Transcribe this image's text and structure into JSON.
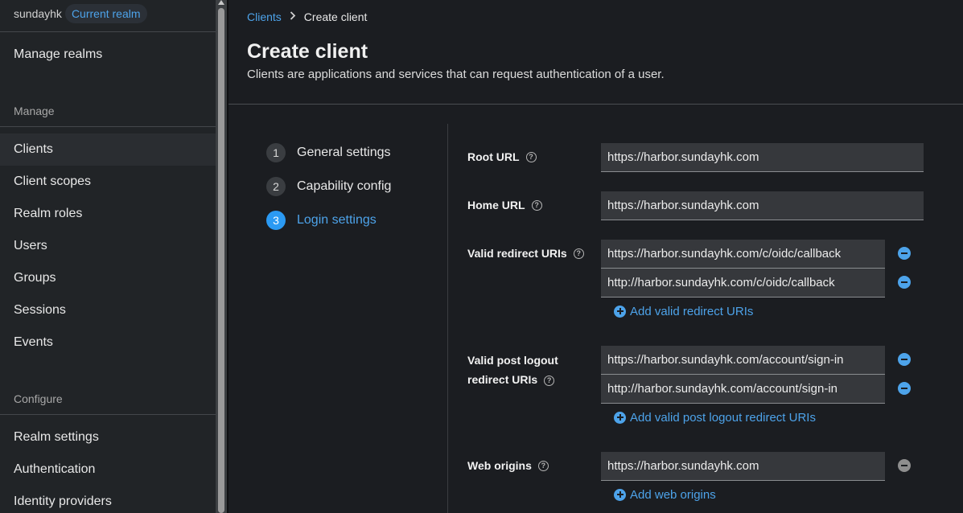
{
  "sidebar": {
    "realm_name": "sundayhk",
    "realm_badge": "Current realm",
    "manage_realms": "Manage realms",
    "manage_section": "Manage",
    "manage_items": [
      {
        "label": "Clients"
      },
      {
        "label": "Client scopes"
      },
      {
        "label": "Realm roles"
      },
      {
        "label": "Users"
      },
      {
        "label": "Groups"
      },
      {
        "label": "Sessions"
      },
      {
        "label": "Events"
      }
    ],
    "configure_section": "Configure",
    "configure_items": [
      {
        "label": "Realm settings"
      },
      {
        "label": "Authentication"
      },
      {
        "label": "Identity providers"
      }
    ]
  },
  "header": {
    "breadcrumb_link": "Clients",
    "breadcrumb_current": "Create client",
    "title": "Create client",
    "description": "Clients are applications and services that can request authentication of a user."
  },
  "wizard": {
    "steps": [
      {
        "number": "1",
        "label": "General settings"
      },
      {
        "number": "2",
        "label": "Capability config"
      },
      {
        "number": "3",
        "label": "Login settings"
      }
    ],
    "current_step": 3
  },
  "form": {
    "root_url": {
      "label": "Root URL",
      "value": "https://harbor.sundayhk.com"
    },
    "home_url": {
      "label": "Home URL",
      "value": "https://harbor.sundayhk.com"
    },
    "redirect_uris": {
      "label": "Valid redirect URIs",
      "values": [
        "https://harbor.sundayhk.com/c/oidc/callback",
        "http://harbor.sundayhk.com/c/oidc/callback"
      ],
      "add_label": "Add valid redirect URIs"
    },
    "post_logout": {
      "label_line1": "Valid post logout",
      "label_line2": "redirect URIs",
      "values": [
        "https://harbor.sundayhk.com/account/sign-in",
        "http://harbor.sundayhk.com/account/sign-in"
      ],
      "add_label": "Add valid post logout redirect URIs"
    },
    "web_origins": {
      "label": "Web origins",
      "values": [
        "https://harbor.sundayhk.com"
      ],
      "add_label": "Add web origins"
    }
  },
  "icons": {
    "help": "question-circle-icon",
    "remove": "minus-circle-icon",
    "add": "plus-circle-icon",
    "breadcrumb_sep": "chevron-right-icon"
  },
  "colors": {
    "accent": "#4da3ea",
    "step_active": "#2b9af3",
    "background": "#1b1d21",
    "sidebar": "#212427",
    "input_bg": "#36383c"
  }
}
